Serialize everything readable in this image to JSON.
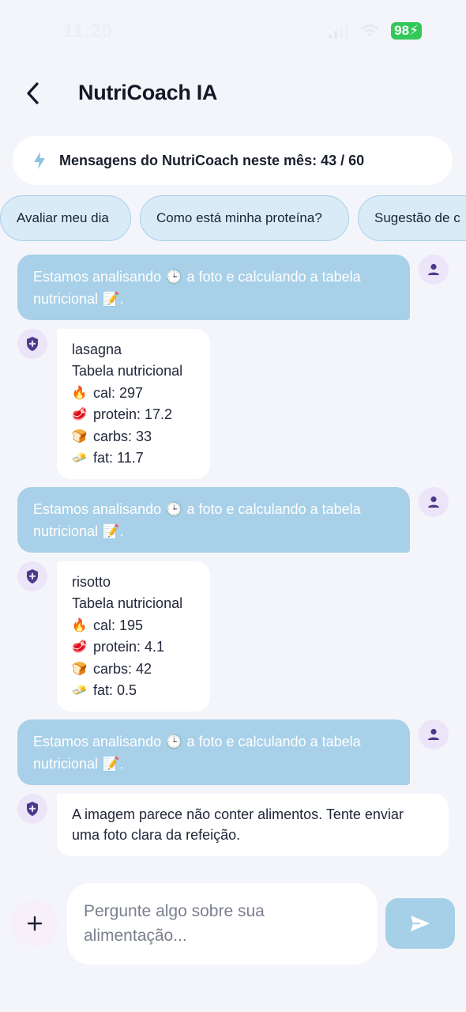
{
  "status_bar": {
    "time": "11:20",
    "battery": "98"
  },
  "header": {
    "title": "NutriCoach IA",
    "back_icon": "chevron-left-icon"
  },
  "quota": {
    "text": "Mensagens do NutriCoach neste mês: 43 / 60",
    "icon": "bolt-icon"
  },
  "chips": [
    {
      "label": "Avaliar meu dia"
    },
    {
      "label": "Como está minha proteína?"
    },
    {
      "label": "Sugestão de c"
    }
  ],
  "messages": [
    {
      "role": "user",
      "text": "Estamos analisando 🕒 a foto e calculando a tabela nutricional 📝."
    },
    {
      "role": "bot",
      "food": "lasagna",
      "heading": "Tabela nutricional",
      "nutrients": [
        {
          "icon": "🔥",
          "label": "cal: 297"
        },
        {
          "icon": "🥩",
          "label": "protein: 17.2"
        },
        {
          "icon": "🍞",
          "label": "carbs: 33"
        },
        {
          "icon": "🧈",
          "label": "fat: 11.7"
        }
      ]
    },
    {
      "role": "user",
      "text": "Estamos analisando 🕒 a foto e calculando a tabela nutricional 📝."
    },
    {
      "role": "bot",
      "food": "risotto",
      "heading": "Tabela nutricional",
      "nutrients": [
        {
          "icon": "🔥",
          "label": "cal: 195"
        },
        {
          "icon": "🥩",
          "label": "protein: 4.1"
        },
        {
          "icon": "🍞",
          "label": "carbs: 42"
        },
        {
          "icon": "🧈",
          "label": "fat: 0.5"
        }
      ]
    },
    {
      "role": "user",
      "text": "Estamos analisando 🕒 a foto e calculando a tabela nutricional 📝."
    },
    {
      "role": "bot",
      "text": "A imagem parece não conter alimentos. Tente enviar uma foto clara da refeição."
    }
  ],
  "composer": {
    "placeholder": "Pergunte algo sobre sua alimentação...",
    "add_icon": "plus-icon",
    "send_icon": "send-icon"
  },
  "colors": {
    "user_bubble": "#a8d0e8",
    "chip_bg": "#d9ebf7",
    "avatar_bg": "#ece4f8",
    "avatar_icon": "#4a3a8c",
    "battery": "#34c759"
  }
}
